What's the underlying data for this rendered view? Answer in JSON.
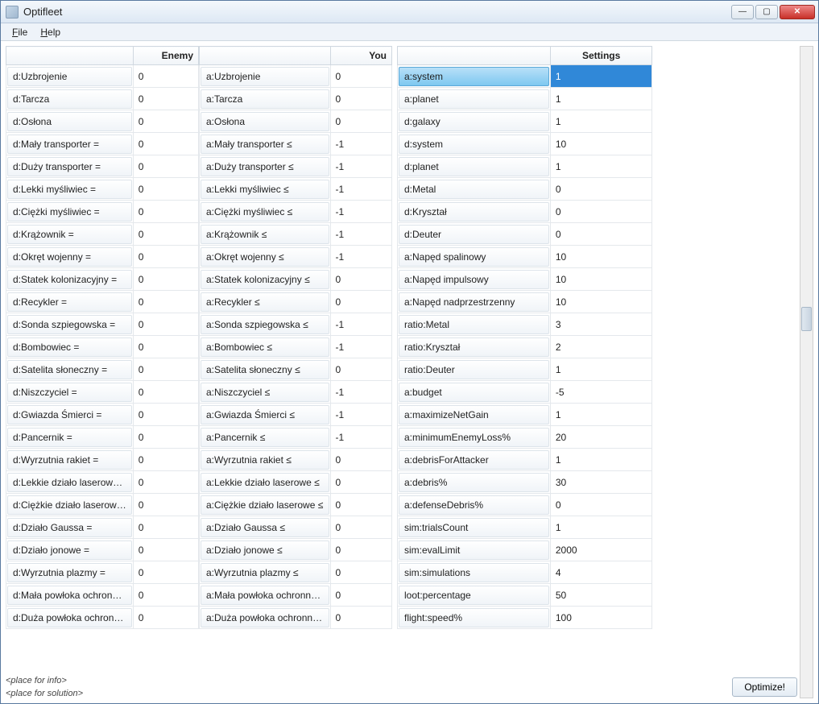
{
  "window": {
    "title": "Optifleet"
  },
  "menu": {
    "file": "File",
    "help": "Help"
  },
  "headers": {
    "enemy": "Enemy",
    "you": "You",
    "settings": "Settings"
  },
  "enemy_rows": [
    {
      "label": "d:Uzbrojenie",
      "value": "0"
    },
    {
      "label": "d:Tarcza",
      "value": "0"
    },
    {
      "label": "d:Osłona",
      "value": "0"
    },
    {
      "label": "d:Mały transporter =",
      "value": "0"
    },
    {
      "label": "d:Duży transporter =",
      "value": "0"
    },
    {
      "label": "d:Lekki myśliwiec =",
      "value": "0"
    },
    {
      "label": "d:Ciężki myśliwiec =",
      "value": "0"
    },
    {
      "label": "d:Krążownik =",
      "value": "0"
    },
    {
      "label": "d:Okręt wojenny =",
      "value": "0"
    },
    {
      "label": "d:Statek kolonizacyjny =",
      "value": "0"
    },
    {
      "label": "d:Recykler =",
      "value": "0"
    },
    {
      "label": "d:Sonda szpiegowska =",
      "value": "0"
    },
    {
      "label": "d:Bombowiec =",
      "value": "0"
    },
    {
      "label": "d:Satelita słoneczny =",
      "value": "0"
    },
    {
      "label": "d:Niszczyciel =",
      "value": "0"
    },
    {
      "label": "d:Gwiazda Śmierci =",
      "value": "0"
    },
    {
      "label": "d:Pancernik =",
      "value": "0"
    },
    {
      "label": "d:Wyrzutnia rakiet =",
      "value": "0"
    },
    {
      "label": "d:Lekkie działo laserowe =",
      "value": "0"
    },
    {
      "label": "d:Ciężkie działo laserowe =",
      "value": "0"
    },
    {
      "label": "d:Działo Gaussa =",
      "value": "0"
    },
    {
      "label": "d:Działo jonowe =",
      "value": "0"
    },
    {
      "label": "d:Wyrzutnia plazmy =",
      "value": "0"
    },
    {
      "label": "d:Mała powłoka ochronna =",
      "value": "0"
    },
    {
      "label": "d:Duża powłoka ochronna =",
      "value": "0"
    }
  ],
  "you_rows": [
    {
      "label": "a:Uzbrojenie",
      "value": "0"
    },
    {
      "label": "a:Tarcza",
      "value": "0"
    },
    {
      "label": "a:Osłona",
      "value": "0"
    },
    {
      "label": "a:Mały transporter ≤",
      "value": "-1"
    },
    {
      "label": "a:Duży transporter ≤",
      "value": "-1"
    },
    {
      "label": "a:Lekki myśliwiec ≤",
      "value": "-1"
    },
    {
      "label": "a:Ciężki myśliwiec ≤",
      "value": "-1"
    },
    {
      "label": "a:Krążownik ≤",
      "value": "-1"
    },
    {
      "label": "a:Okręt wojenny ≤",
      "value": "-1"
    },
    {
      "label": "a:Statek kolonizacyjny ≤",
      "value": "0"
    },
    {
      "label": "a:Recykler ≤",
      "value": "0"
    },
    {
      "label": "a:Sonda szpiegowska ≤",
      "value": "-1"
    },
    {
      "label": "a:Bombowiec ≤",
      "value": "-1"
    },
    {
      "label": "a:Satelita słoneczny ≤",
      "value": "0"
    },
    {
      "label": "a:Niszczyciel ≤",
      "value": "-1"
    },
    {
      "label": "a:Gwiazda Śmierci ≤",
      "value": "-1"
    },
    {
      "label": "a:Pancernik ≤",
      "value": "-1"
    },
    {
      "label": "a:Wyrzutnia rakiet ≤",
      "value": "0"
    },
    {
      "label": "a:Lekkie działo laserowe ≤",
      "value": "0"
    },
    {
      "label": "a:Ciężkie działo laserowe ≤",
      "value": "0"
    },
    {
      "label": "a:Działo Gaussa ≤",
      "value": "0"
    },
    {
      "label": "a:Działo jonowe ≤",
      "value": "0"
    },
    {
      "label": "a:Wyrzutnia plazmy ≤",
      "value": "0"
    },
    {
      "label": "a:Mała powłoka ochronna ≤",
      "value": "0"
    },
    {
      "label": "a:Duża powłoka ochronna ≤",
      "value": "0"
    }
  ],
  "settings_rows": [
    {
      "label": "a:system",
      "value": "1",
      "selected": true
    },
    {
      "label": "a:planet",
      "value": "1"
    },
    {
      "label": "d:galaxy",
      "value": "1"
    },
    {
      "label": "d:system",
      "value": "10"
    },
    {
      "label": "d:planet",
      "value": "1"
    },
    {
      "label": "d:Metal",
      "value": "0"
    },
    {
      "label": "d:Kryształ",
      "value": "0"
    },
    {
      "label": "d:Deuter",
      "value": "0"
    },
    {
      "label": "a:Napęd spalinowy",
      "value": "10"
    },
    {
      "label": "a:Napęd impulsowy",
      "value": "10"
    },
    {
      "label": "a:Napęd nadprzestrzenny",
      "value": "10"
    },
    {
      "label": "ratio:Metal",
      "value": "3"
    },
    {
      "label": "ratio:Kryształ",
      "value": "2"
    },
    {
      "label": "ratio:Deuter",
      "value": "1"
    },
    {
      "label": "a:budget",
      "value": "-5"
    },
    {
      "label": "a:maximizeNetGain",
      "value": "1"
    },
    {
      "label": "a:minimumEnemyLoss%",
      "value": "20"
    },
    {
      "label": "a:debrisForAttacker",
      "value": "1"
    },
    {
      "label": "a:debris%",
      "value": "30"
    },
    {
      "label": "a:defenseDebris%",
      "value": "0"
    },
    {
      "label": "sim:trialsCount",
      "value": "1"
    },
    {
      "label": "sim:evalLimit",
      "value": "2000"
    },
    {
      "label": "sim:simulations",
      "value": "4"
    },
    {
      "label": "loot:percentage",
      "value": "50"
    },
    {
      "label": "flight:speed%",
      "value": "100"
    }
  ],
  "footer": {
    "info": "<place for info>",
    "solution": "<place for solution>"
  },
  "buttons": {
    "optimize": "Optimize!"
  }
}
